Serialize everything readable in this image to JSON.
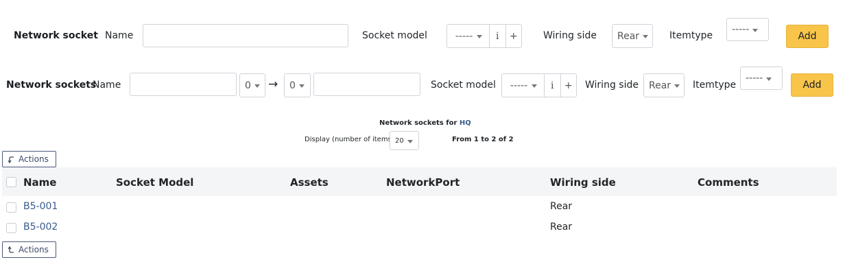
{
  "single_form": {
    "title": "Network socket",
    "name_label": "Name",
    "name_value": "",
    "socket_model_label": "Socket model",
    "socket_model_value": "-----",
    "info_glyph": "i",
    "plus_glyph": "+",
    "wiring_side_label": "Wiring side",
    "wiring_side_value": "Rear",
    "itemtype_label": "Itemtype",
    "itemtype_value": "-----",
    "add_label": "Add"
  },
  "multi_form": {
    "title": "Network sockets",
    "name_label": "Name",
    "prefix_value": "",
    "from_value": "0",
    "arrow": "→",
    "to_value": "0",
    "suffix_value": "",
    "socket_model_label": "Socket model",
    "socket_model_value": "-----",
    "info_glyph": "i",
    "plus_glyph": "+",
    "wiring_side_label": "Wiring side",
    "wiring_side_value": "Rear",
    "itemtype_label": "Itemtype",
    "itemtype_value": "-----",
    "add_label": "Add"
  },
  "list": {
    "title_prefix": "Network sockets for",
    "title_entity": "HQ",
    "display_label": "Display (number of items)",
    "display_value": "20",
    "pager_text": "From 1 to 2 of 2",
    "actions_label": "Actions",
    "columns": [
      "Name",
      "Socket Model",
      "Assets",
      "NetworkPort",
      "Wiring side",
      "Comments"
    ],
    "rows": [
      {
        "name": "B5-001",
        "socket_model": "",
        "assets": "",
        "networkport": "",
        "wiring_side": "Rear",
        "comments": ""
      },
      {
        "name": "B5-002",
        "socket_model": "",
        "assets": "",
        "networkport": "",
        "wiring_side": "Rear",
        "comments": ""
      }
    ]
  },
  "colors": {
    "accent_button": "#f8c54a",
    "link": "#3a5a8c",
    "table_header_bg": "#f4f5f6"
  }
}
